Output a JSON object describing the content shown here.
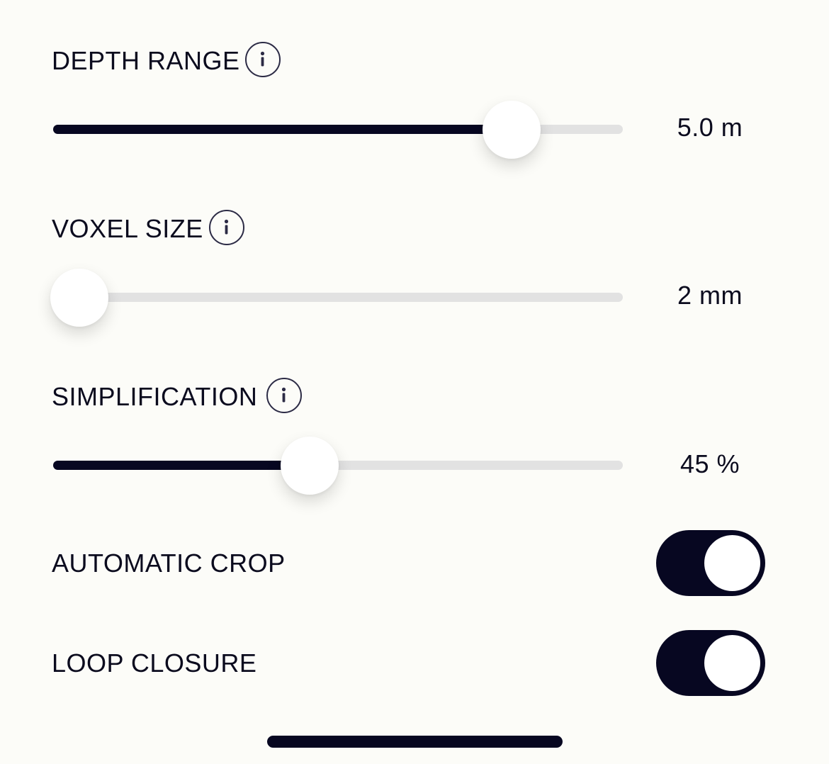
{
  "settings": {
    "depth_range": {
      "label": "DEPTH RANGE",
      "value_text": "5.0 m",
      "fraction": 0.805,
      "info_icon": "info-icon"
    },
    "voxel_size": {
      "label": "VOXEL SIZE",
      "value_text": "2 mm",
      "fraction": 0.0,
      "info_icon": "info-icon"
    },
    "simplification": {
      "label": "SIMPLIFICATION",
      "value_text": "45 %",
      "fraction": 0.45,
      "info_icon": "info-icon"
    },
    "automatic_crop": {
      "label": "AUTOMATIC CROP",
      "enabled": true
    },
    "loop_closure": {
      "label": "LOOP CLOSURE",
      "enabled": true
    }
  },
  "colors": {
    "background": "#fcfcf8",
    "accent": "#070721",
    "track": "#e2e2e2",
    "text": "#0b0b1e"
  }
}
